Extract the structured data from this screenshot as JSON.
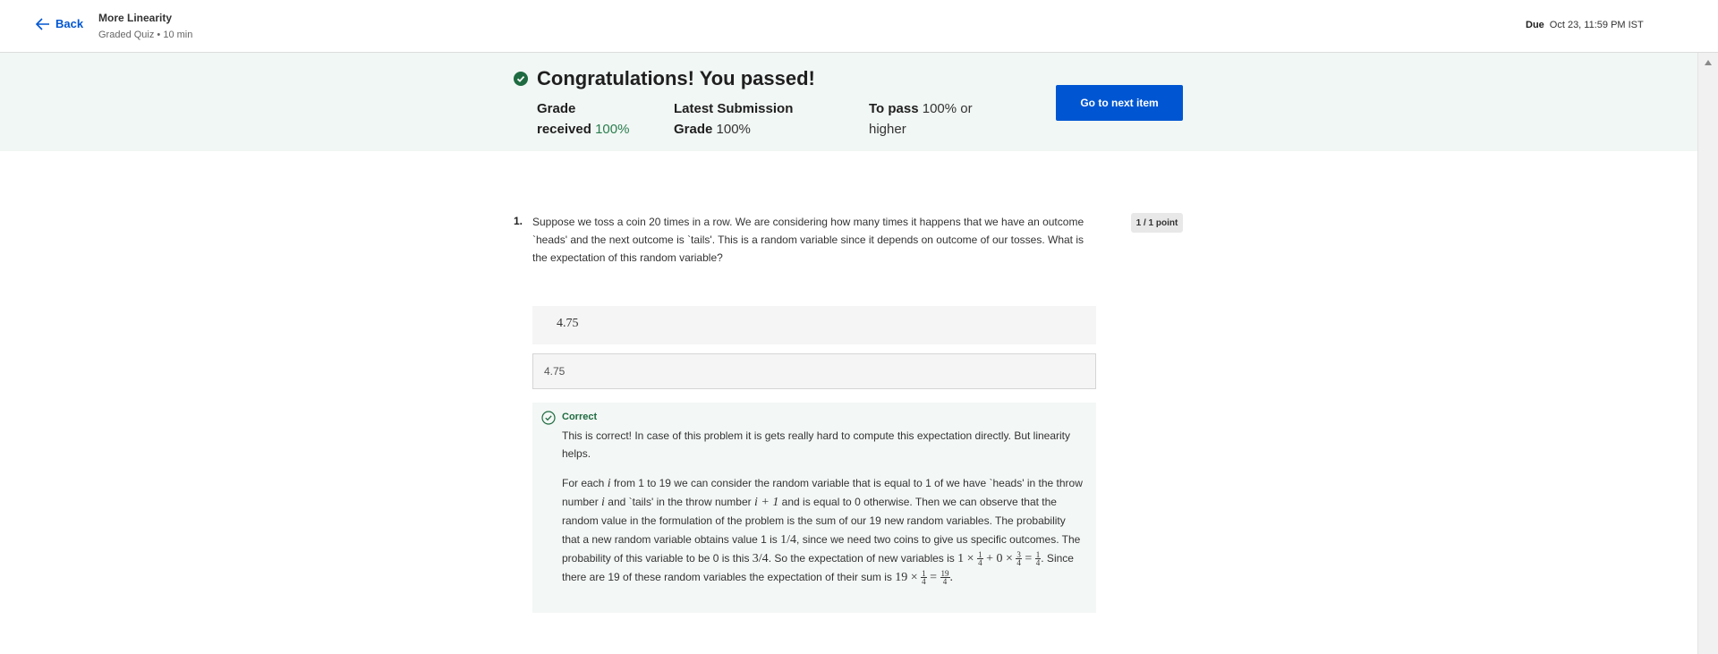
{
  "header": {
    "back_label": "Back",
    "title": "More Linearity",
    "subtitle": "Graded Quiz • 10 min",
    "due_label": "Due",
    "due_value": "Oct 23, 11:59 PM IST"
  },
  "banner": {
    "title": "Congratulations! You passed!",
    "grade_label_1": "Grade",
    "grade_label_2": "received",
    "grade_value": "100%",
    "latest_label_1": "Latest Submission",
    "latest_label_2": "Grade",
    "latest_value": "100%",
    "pass_label": "To pass",
    "pass_value_1": "100% or",
    "pass_value_2": "higher",
    "next_button": "Go to next item"
  },
  "question": {
    "number": "1.",
    "text": "Suppose we toss a coin 20 times in a row. We are considering how many times it happens that we have an outcome `heads' and the next outcome is `tails'. This is a random variable since it depends on outcome of our tosses. What is the expectation of this random variable?",
    "points": "1 / 1 point",
    "rendered_answer": "4.75",
    "input_value": "4.75"
  },
  "feedback": {
    "status": "Correct",
    "p1": "This is correct! In case of this problem it is gets really hard to compute this expectation directly. But linearity helps.",
    "p2_a": "For each",
    "p2_b": "from 1 to 19 we can consider the random variable that is equal to 1 of we have `heads' in the throw number",
    "p2_c": "and `tails' in the throw number",
    "p2_d": "and is equal to 0 otherwise. Then we can observe that the random value in the formulation of the problem is the sum of our 19 new random variables. The probability that a new random variable obtains value 1 is",
    "p2_e": ", since we need two coins to give us specific outcomes. The probability of this variable to be 0 is this",
    "p2_f": ". So the expectation of new variables is",
    "p2_g": ". Since there are 19 of these random variables the expectation of their sum is",
    "math_i": "i",
    "math_i1": "i + 1",
    "math_quarter": "1/4",
    "math_three_quarter": "3/4"
  }
}
